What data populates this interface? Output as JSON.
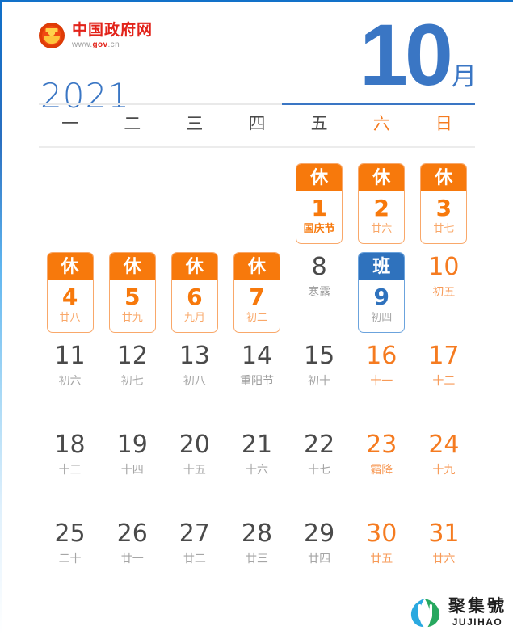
{
  "page": {
    "accent_blue": "#3a76c4",
    "accent_orange": "#f57b20",
    "rest_badge_color": "#f7790c",
    "work_badge_color": "#2f72bd",
    "brand_red": "#e2231a"
  },
  "header": {
    "emblem_icon": "china-national-emblem-icon",
    "site_name": "中国政府网",
    "site_url_prefix": "www.",
    "site_url_mid": "gov",
    "site_url_suffix": ".cn",
    "year": "2021",
    "month_number": "10",
    "month_unit": "月"
  },
  "weekdays": [
    {
      "label": "一",
      "weekend": false
    },
    {
      "label": "二",
      "weekend": false
    },
    {
      "label": "三",
      "weekend": false
    },
    {
      "label": "四",
      "weekend": false
    },
    {
      "label": "五",
      "weekend": false
    },
    {
      "label": "六",
      "weekend": true
    },
    {
      "label": "日",
      "weekend": true
    }
  ],
  "legend": {
    "rest_label": "休",
    "work_label": "班"
  },
  "days": [
    {
      "blank": true
    },
    {
      "blank": true
    },
    {
      "blank": true
    },
    {
      "blank": true
    },
    {
      "num": "1",
      "lunar": "国庆节",
      "badge": "rest",
      "badge_label": "休",
      "festival": true,
      "weekend": false,
      "term": false
    },
    {
      "num": "2",
      "lunar": "廿六",
      "badge": "rest",
      "badge_label": "休",
      "festival": false,
      "weekend": true,
      "term": false
    },
    {
      "num": "3",
      "lunar": "廿七",
      "badge": "rest",
      "badge_label": "休",
      "festival": false,
      "weekend": true,
      "term": false
    },
    {
      "num": "4",
      "lunar": "廿八",
      "badge": "rest",
      "badge_label": "休",
      "festival": false,
      "weekend": false,
      "term": false
    },
    {
      "num": "5",
      "lunar": "廿九",
      "badge": "rest",
      "badge_label": "休",
      "festival": false,
      "weekend": false,
      "term": false
    },
    {
      "num": "6",
      "lunar": "九月",
      "badge": "rest",
      "badge_label": "休",
      "festival": false,
      "weekend": false,
      "term": false
    },
    {
      "num": "7",
      "lunar": "初二",
      "badge": "rest",
      "badge_label": "休",
      "festival": false,
      "weekend": false,
      "term": false
    },
    {
      "num": "8",
      "lunar": "寒露",
      "badge": null,
      "badge_label": "",
      "festival": false,
      "weekend": false,
      "term": true
    },
    {
      "num": "9",
      "lunar": "初四",
      "badge": "work",
      "badge_label": "班",
      "festival": false,
      "weekend": true,
      "term": false
    },
    {
      "num": "10",
      "lunar": "初五",
      "badge": null,
      "badge_label": "",
      "festival": false,
      "weekend": true,
      "term": false
    },
    {
      "num": "11",
      "lunar": "初六",
      "badge": null,
      "badge_label": "",
      "festival": false,
      "weekend": false,
      "term": false
    },
    {
      "num": "12",
      "lunar": "初七",
      "badge": null,
      "badge_label": "",
      "festival": false,
      "weekend": false,
      "term": false
    },
    {
      "num": "13",
      "lunar": "初八",
      "badge": null,
      "badge_label": "",
      "festival": false,
      "weekend": false,
      "term": false
    },
    {
      "num": "14",
      "lunar": "重阳节",
      "badge": null,
      "badge_label": "",
      "festival": false,
      "weekend": false,
      "term": true
    },
    {
      "num": "15",
      "lunar": "初十",
      "badge": null,
      "badge_label": "",
      "festival": false,
      "weekend": false,
      "term": false
    },
    {
      "num": "16",
      "lunar": "十一",
      "badge": null,
      "badge_label": "",
      "festival": false,
      "weekend": true,
      "term": false
    },
    {
      "num": "17",
      "lunar": "十二",
      "badge": null,
      "badge_label": "",
      "festival": false,
      "weekend": true,
      "term": false
    },
    {
      "num": "18",
      "lunar": "十三",
      "badge": null,
      "badge_label": "",
      "festival": false,
      "weekend": false,
      "term": false
    },
    {
      "num": "19",
      "lunar": "十四",
      "badge": null,
      "badge_label": "",
      "festival": false,
      "weekend": false,
      "term": false
    },
    {
      "num": "20",
      "lunar": "十五",
      "badge": null,
      "badge_label": "",
      "festival": false,
      "weekend": false,
      "term": false
    },
    {
      "num": "21",
      "lunar": "十六",
      "badge": null,
      "badge_label": "",
      "festival": false,
      "weekend": false,
      "term": false
    },
    {
      "num": "22",
      "lunar": "十七",
      "badge": null,
      "badge_label": "",
      "festival": false,
      "weekend": false,
      "term": false
    },
    {
      "num": "23",
      "lunar": "霜降",
      "badge": null,
      "badge_label": "",
      "festival": false,
      "weekend": true,
      "term": true
    },
    {
      "num": "24",
      "lunar": "十九",
      "badge": null,
      "badge_label": "",
      "festival": false,
      "weekend": true,
      "term": false
    },
    {
      "num": "25",
      "lunar": "二十",
      "badge": null,
      "badge_label": "",
      "festival": false,
      "weekend": false,
      "term": false
    },
    {
      "num": "26",
      "lunar": "廿一",
      "badge": null,
      "badge_label": "",
      "festival": false,
      "weekend": false,
      "term": false
    },
    {
      "num": "27",
      "lunar": "廿二",
      "badge": null,
      "badge_label": "",
      "festival": false,
      "weekend": false,
      "term": false
    },
    {
      "num": "28",
      "lunar": "廿三",
      "badge": null,
      "badge_label": "",
      "festival": false,
      "weekend": false,
      "term": false
    },
    {
      "num": "29",
      "lunar": "廿四",
      "badge": null,
      "badge_label": "",
      "festival": false,
      "weekend": false,
      "term": false
    },
    {
      "num": "30",
      "lunar": "廿五",
      "badge": null,
      "badge_label": "",
      "festival": false,
      "weekend": true,
      "term": false
    },
    {
      "num": "31",
      "lunar": "廿六",
      "badge": null,
      "badge_label": "",
      "festival": false,
      "weekend": true,
      "term": false
    }
  ],
  "watermark": {
    "logo_icon": "jujihao-leaf-logo-icon",
    "name_cn": "聚集號",
    "name_en": "JUJIHAO"
  }
}
